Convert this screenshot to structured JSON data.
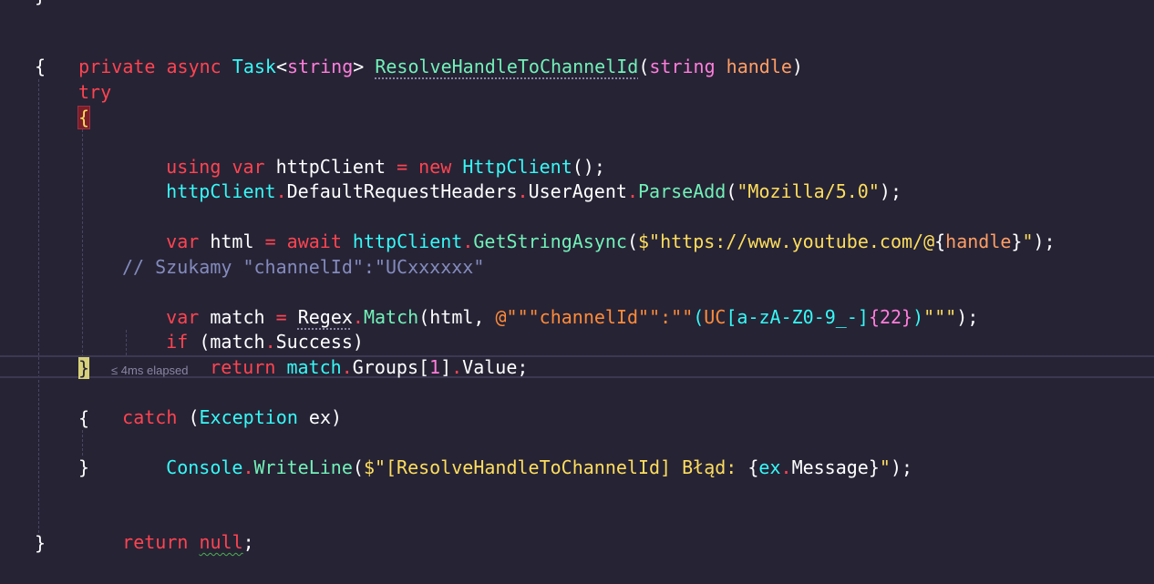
{
  "code": {
    "line_sig": {
      "private": "private",
      "async": "async",
      "task": "Task",
      "lt": "<",
      "string": "string",
      "gt": ">",
      "fn": "ResolveHandleToChannelId",
      "open": "(",
      "string2": "string",
      "param": "handle",
      "close": ")"
    },
    "open_brace": "{",
    "try": "try",
    "try_open": "{",
    "using_line": {
      "using": "using",
      "var": "var",
      "name": "httpClient",
      "eq": "=",
      "new": "new",
      "type": "HttpClient",
      "tail": "();"
    },
    "ua_line": {
      "obj": "httpClient",
      "dot1": ".",
      "prop1": "DefaultRequestHeaders",
      "dot2": ".",
      "prop2": "UserAgent",
      "dot3": ".",
      "fn": "ParseAdd",
      "open": "(",
      "str": "\"Mozilla/5.0\"",
      "close": ");"
    },
    "html_line": {
      "var": "var",
      "name": "html",
      "eq": "=",
      "await": "await",
      "obj": "httpClient",
      "dot": ".",
      "fn": "GetStringAsync",
      "open": "(",
      "str_start": "$\"https://www.youtube.com/@",
      "interp_open": "{",
      "interp": "handle",
      "interp_close": "}",
      "str_end": "\"",
      "close": ");"
    },
    "comment": "// Szukamy \"channelId\":\"UCxxxxxx\"",
    "match_line": {
      "var": "var",
      "name": "match",
      "eq": "=",
      "type": "Regex",
      "dot": ".",
      "fn": "Match",
      "open": "(",
      "arg": "html",
      "comma": ",",
      "str1": "@\"\"\"channelId\"\":\"\"",
      "paren_open": "(",
      "uc": "UC",
      "class": "[a-zA-Z0-9_-]",
      "quant": "{22}",
      "paren_close": ")",
      "str2": "\"\"\"",
      "close": ");"
    },
    "if_line": {
      "if": "if",
      "open": "(",
      "obj": "match",
      "dot": ".",
      "prop": "Success",
      "close": ")"
    },
    "return_line": {
      "return": "return",
      "obj": "match",
      "dot1": ".",
      "prop": "Groups",
      "bopen": "[",
      "num": "1",
      "bclose": "]",
      "dot2": ".",
      "value": "Value",
      "semi": ";"
    },
    "try_close": "}",
    "elapsed": "≤ 4ms elapsed",
    "catch_line": {
      "catch": "catch",
      "open": "(",
      "type": "Exception",
      "name": "ex",
      "close": ")"
    },
    "catch_open": "{",
    "console_line": {
      "obj": "Console",
      "dot": ".",
      "fn": "WriteLine",
      "open": "(",
      "str_start": "$\"[ResolveHandleToChannelId] Błąd: ",
      "interp_open": "{",
      "obj2": "ex",
      "dot2": ".",
      "prop": "Message",
      "interp_close": "}",
      "str_end": "\"",
      "close": ");"
    },
    "catch_close": "}",
    "return_null": {
      "return": "return",
      "null": "null",
      "semi": ";"
    },
    "close_brace": "}"
  }
}
